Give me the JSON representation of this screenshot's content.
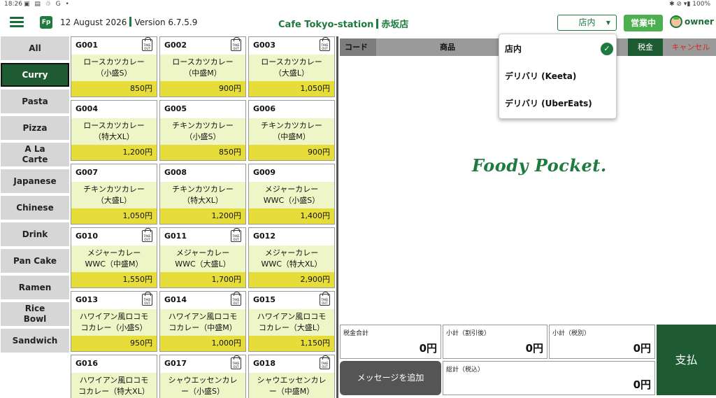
{
  "status_bar": {
    "time": "18:26",
    "left_icons": "▣ ▤ ♲ G •",
    "right": "✱ ⊘ ▾▮ 100%"
  },
  "header": {
    "logo": "Fp",
    "date": "12 August 2026",
    "version": "Version 6.7.5.9",
    "store": "Cafe Tokyo-station",
    "branch": "赤坂店",
    "mode_selected": "店内",
    "open_button": "営業中",
    "user": "owner"
  },
  "categories": [
    "All",
    "Curry",
    "Pasta",
    "Pizza",
    "A La Carte",
    "Japanese",
    "Chinese",
    "Drink",
    "Pan Cake",
    "Ramen",
    "Rice Bowl",
    "Sandwich"
  ],
  "active_category": "Curry",
  "products": [
    {
      "code": "G001",
      "name": "ロースカツカレー（小盛S）",
      "price": "850円",
      "takeout": true
    },
    {
      "code": "G002",
      "name": "ロースカツカレー（中盛M）",
      "price": "900円",
      "takeout": true
    },
    {
      "code": "G003",
      "name": "ロースカツカレー（大盛L）",
      "price": "1,050円",
      "takeout": true
    },
    {
      "code": "G004",
      "name": "ロースカツカレー（特大XL）",
      "price": "1,200円",
      "takeout": false
    },
    {
      "code": "G005",
      "name": "チキンカツカレー（小盛S）",
      "price": "850円",
      "takeout": false
    },
    {
      "code": "G006",
      "name": "チキンカツカレー（中盛M）",
      "price": "900円",
      "takeout": false
    },
    {
      "code": "G007",
      "name": "チキンカツカレー（大盛L）",
      "price": "1,050円",
      "takeout": false
    },
    {
      "code": "G008",
      "name": "チキンカツカレー（特大XL）",
      "price": "1,200円",
      "takeout": false
    },
    {
      "code": "G009",
      "name": "メジャーカレー WWC（小盛S）",
      "price": "1,400円",
      "takeout": false
    },
    {
      "code": "G010",
      "name": "メジャーカレー WWC（中盛M）",
      "price": "1,550円",
      "takeout": true
    },
    {
      "code": "G011",
      "name": "メジャーカレー WWC（大盛L）",
      "price": "1,700円",
      "takeout": true
    },
    {
      "code": "G012",
      "name": "メジャーカレー WWC（特大XL）",
      "price": "2,900円",
      "takeout": false
    },
    {
      "code": "G013",
      "name": "ハワイアン風ロコモコカレー（小盛S）",
      "price": "950円",
      "takeout": true
    },
    {
      "code": "G014",
      "name": "ハワイアン風ロコモコカレー（中盛M）",
      "price": "1,000円",
      "takeout": true
    },
    {
      "code": "G015",
      "name": "ハワイアン風ロコモコカレー（大盛L）",
      "price": "1,150円",
      "takeout": true
    },
    {
      "code": "G016",
      "name": "ハワイアン風ロコモコカレー（特大XL）",
      "price": "",
      "takeout": false
    },
    {
      "code": "G017",
      "name": "シャウエッセンカレー（小盛S）",
      "price": "",
      "takeout": true
    },
    {
      "code": "G018",
      "name": "シャウエッセンカレー（中盛M）",
      "price": "",
      "takeout": true
    }
  ],
  "product_name_lines": [
    [
      "ロースカツカレー",
      "（小盛S）"
    ],
    [
      "ロースカツカレー",
      "（中盛M）"
    ],
    [
      "ロースカツカレー",
      "（大盛L）"
    ],
    [
      "ロースカツカレー",
      "（特大XL）"
    ],
    [
      "チキンカツカレー",
      "（小盛S）"
    ],
    [
      "チキンカツカレー",
      "（中盛M）"
    ],
    [
      "チキンカツカレー",
      "（大盛L）"
    ],
    [
      "チキンカツカレー",
      "（特大XL）"
    ],
    [
      "メジャーカレー",
      "WWC（小盛S）"
    ],
    [
      "メジャーカレー",
      "WWC（中盛M）"
    ],
    [
      "メジャーカレー",
      "WWC（大盛L）"
    ],
    [
      "メジャーカレー",
      "WWC（特大XL）"
    ],
    [
      "ハワイアン風ロコモ",
      "コカレー（小盛S）"
    ],
    [
      "ハワイアン風ロコモ",
      "コカレー（中盛M）"
    ],
    [
      "ハワイアン風ロコモ",
      "コカレー（大盛L）"
    ],
    [
      "ハワイアン風ロコモ",
      "コカレー（特大XL）"
    ],
    [
      "シャウエッセンカレ",
      "ー（小盛S）"
    ],
    [
      "シャウエッセンカレ",
      "ー（中盛M）"
    ]
  ],
  "takeout_label": "TAKE OUT",
  "order_table": {
    "col_code": "コード",
    "col_name": "商品",
    "tax_button": "税金",
    "cancel_button": "キャンセル"
  },
  "brand": "Foody Pocket.",
  "mode_dropdown": {
    "options": [
      "店内",
      "デリバリ (Keeta)",
      "デリバリ (UberEats)"
    ],
    "selected_index": 0
  },
  "totals": {
    "tax_total_label": "税金合計",
    "tax_total_value": "0円",
    "subtotal_discount_label": "小計（割引後）",
    "subtotal_discount_value": "0円",
    "subtotal_ex_tax_label": "小計（税別）",
    "subtotal_ex_tax_value": "0円",
    "grand_total_label": "総計（税込）",
    "grand_total_value": "0円"
  },
  "message_button": "メッセージを追加",
  "pay_button": "支払",
  "colors": {
    "brand_green": "#1e7a3e",
    "dark_green": "#1e5b33",
    "price_yellow": "#e6dc3a",
    "name_bg": "#eef6c8"
  }
}
